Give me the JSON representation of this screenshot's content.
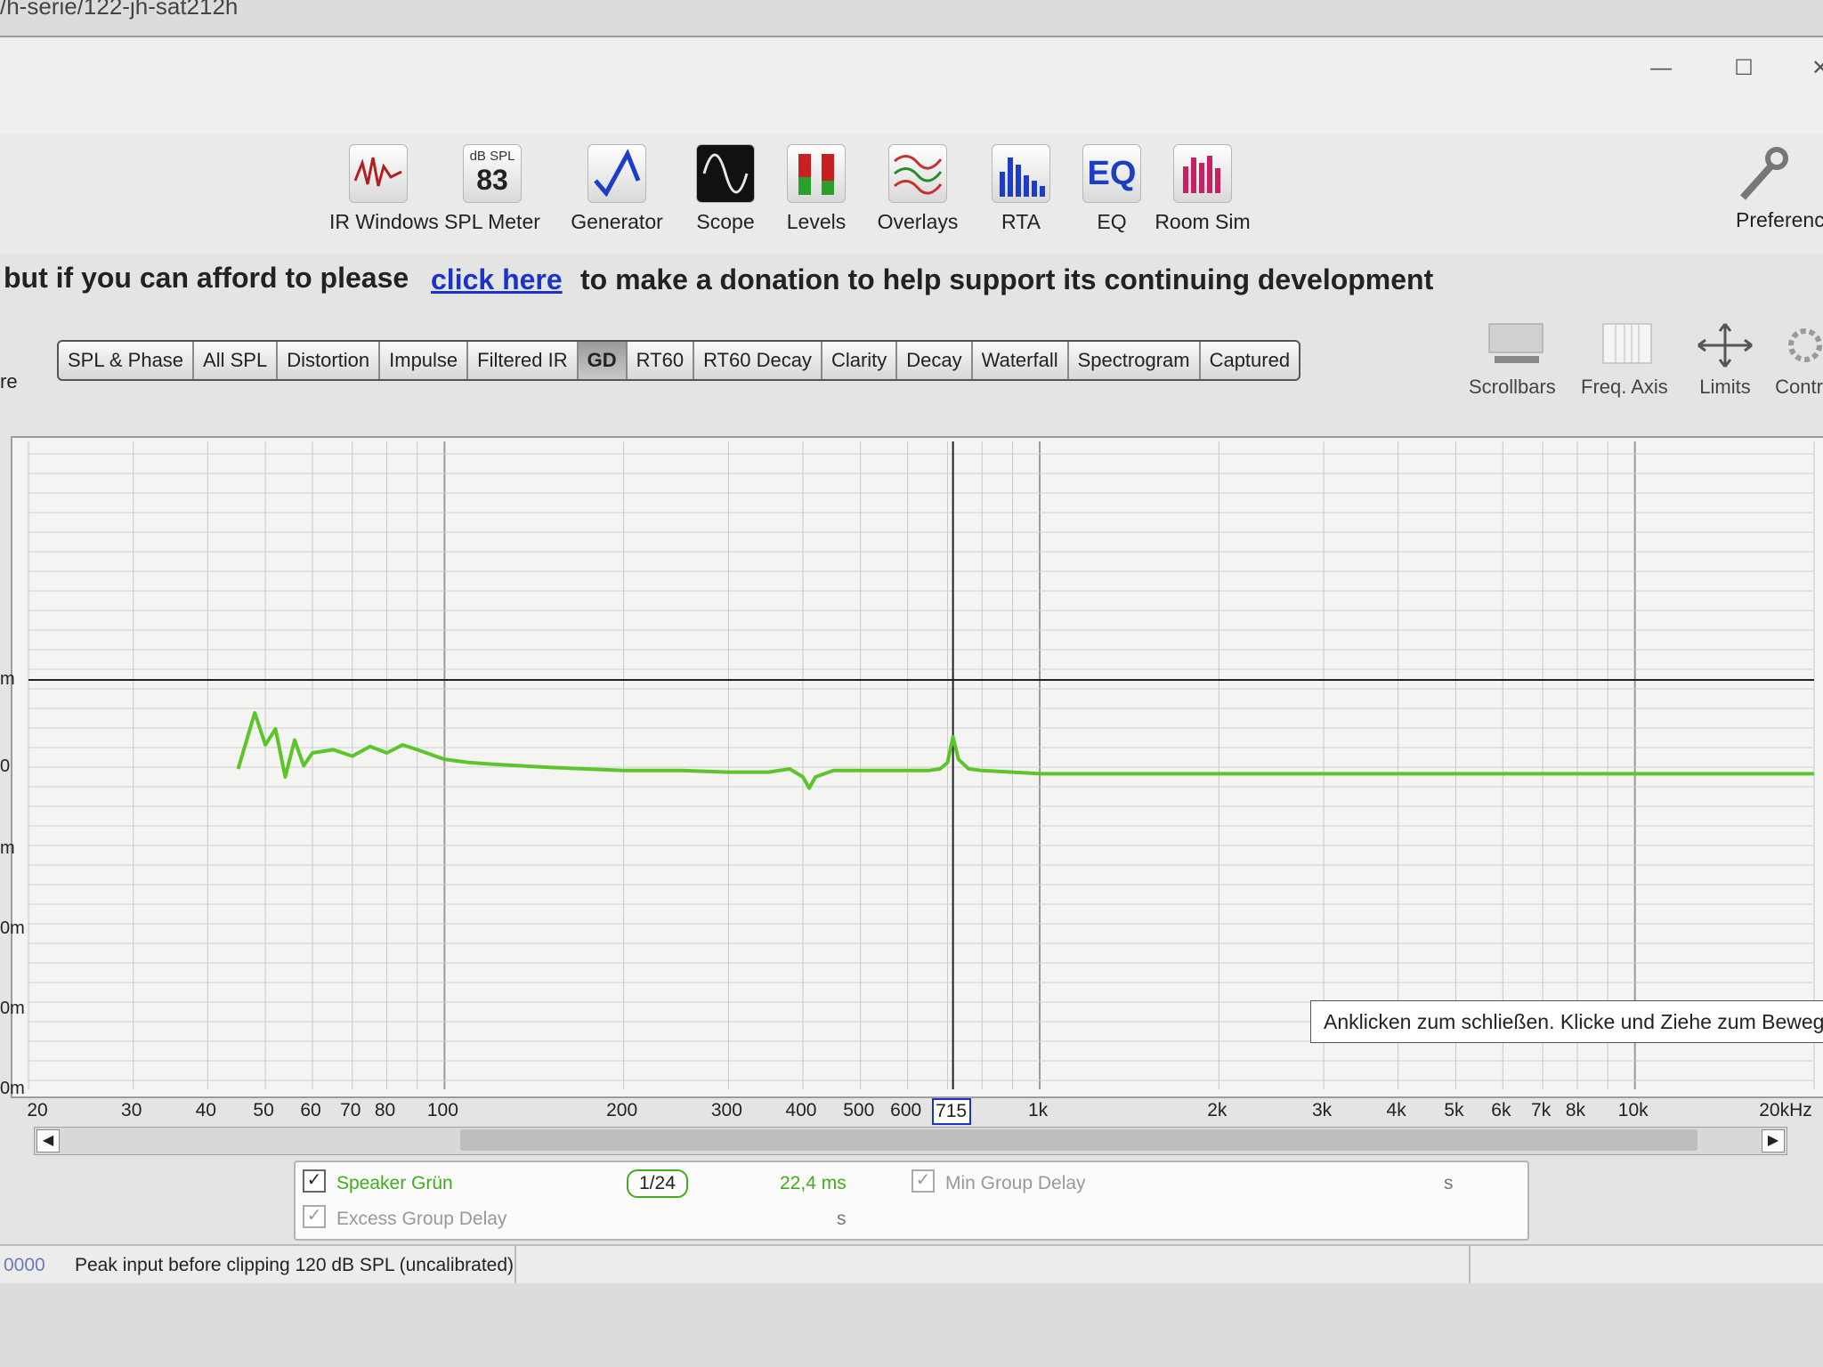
{
  "window": {
    "title_path": "/h-serie/122-jh-sat212h",
    "minimize_glyph": "—",
    "maximize_glyph": "☐",
    "close_glyph": "✕"
  },
  "toolbar": {
    "items": [
      {
        "label": "IR Windows",
        "icon": "ir-windows-icon"
      },
      {
        "label": "SPL Meter",
        "icon": "spl-meter-icon",
        "badge_top": "dB SPL",
        "badge_value": "83"
      },
      {
        "label": "Generator",
        "icon": "generator-icon"
      },
      {
        "label": "Scope",
        "icon": "scope-icon"
      },
      {
        "label": "Levels",
        "icon": "levels-icon"
      },
      {
        "label": "Overlays",
        "icon": "overlays-icon"
      },
      {
        "label": "RTA",
        "icon": "rta-icon"
      },
      {
        "label": "EQ",
        "icon": "eq-icon"
      },
      {
        "label": "Room Sim",
        "icon": "room-sim-icon"
      }
    ],
    "preferences_label": "Preferenc"
  },
  "donation": {
    "prefix": "but if you can afford to please",
    "link": "click here",
    "suffix": "to make a donation to help support its continuing development"
  },
  "side_label": "re",
  "graph_tabs": {
    "items": [
      "SPL & Phase",
      "All SPL",
      "Distortion",
      "Impulse",
      "Filtered IR",
      "GD",
      "RT60",
      "RT60 Decay",
      "Clarity",
      "Decay",
      "Waterfall",
      "Spectrogram",
      "Captured"
    ],
    "active": "GD"
  },
  "graph_controls": {
    "scrollbars": "Scrollbars",
    "freq_axis": "Freq. Axis",
    "limits": "Limits",
    "controls": "Contr"
  },
  "chart_data": {
    "type": "line",
    "x_scale": "log",
    "xlim": [
      20,
      20000
    ],
    "x_tick_labels": [
      "20",
      "30",
      "40",
      "50",
      "60",
      "70",
      "80",
      "100",
      "200",
      "300",
      "400",
      "500",
      "600",
      "1k",
      "2k",
      "3k",
      "4k",
      "5k",
      "6k",
      "7k",
      "8k",
      "10k",
      "20kHz"
    ],
    "y_tick_labels": [
      "m",
      "0",
      "m",
      "0m",
      "0m",
      "0m"
    ],
    "cursor_frequency": "715",
    "series": [
      {
        "name": "Speaker Grün",
        "color": "#5cc52a",
        "x": [
          45,
          48,
          50,
          52,
          54,
          56,
          58,
          60,
          65,
          70,
          75,
          80,
          85,
          90,
          100,
          110,
          120,
          150,
          200,
          250,
          300,
          350,
          380,
          400,
          410,
          420,
          450,
          500,
          550,
          600,
          650,
          680,
          700,
          715,
          730,
          760,
          800,
          900,
          1000,
          1200,
          1500,
          2000,
          3000,
          5000,
          10000,
          20000
        ],
        "y_rel": [
          0.0,
          0.35,
          0.15,
          0.25,
          -0.05,
          0.18,
          0.02,
          0.1,
          0.12,
          0.08,
          0.14,
          0.1,
          0.15,
          0.12,
          0.06,
          0.04,
          0.03,
          0.01,
          -0.01,
          -0.01,
          -0.02,
          -0.02,
          0.0,
          -0.05,
          -0.12,
          -0.05,
          -0.01,
          -0.01,
          -0.01,
          -0.01,
          -0.01,
          0.0,
          0.04,
          0.2,
          0.06,
          0.0,
          -0.01,
          -0.02,
          -0.03,
          -0.03,
          -0.03,
          -0.03,
          -0.03,
          -0.03,
          -0.03,
          -0.03
        ]
      }
    ]
  },
  "tooltip": "Anklicken zum schließen. Klicke und Ziehe zum Bewege",
  "legend": {
    "speaker_label": "Speaker Grün",
    "smoothing": "1/24",
    "value": "22,4 ms",
    "min_gd_label": "Min Group Delay",
    "min_gd_unit": "s",
    "excess_gd_label": "Excess Group Delay",
    "excess_gd_unit": "s"
  },
  "status": {
    "left": "0000",
    "message": "Peak input before clipping 120 dB SPL (uncalibrated)"
  }
}
